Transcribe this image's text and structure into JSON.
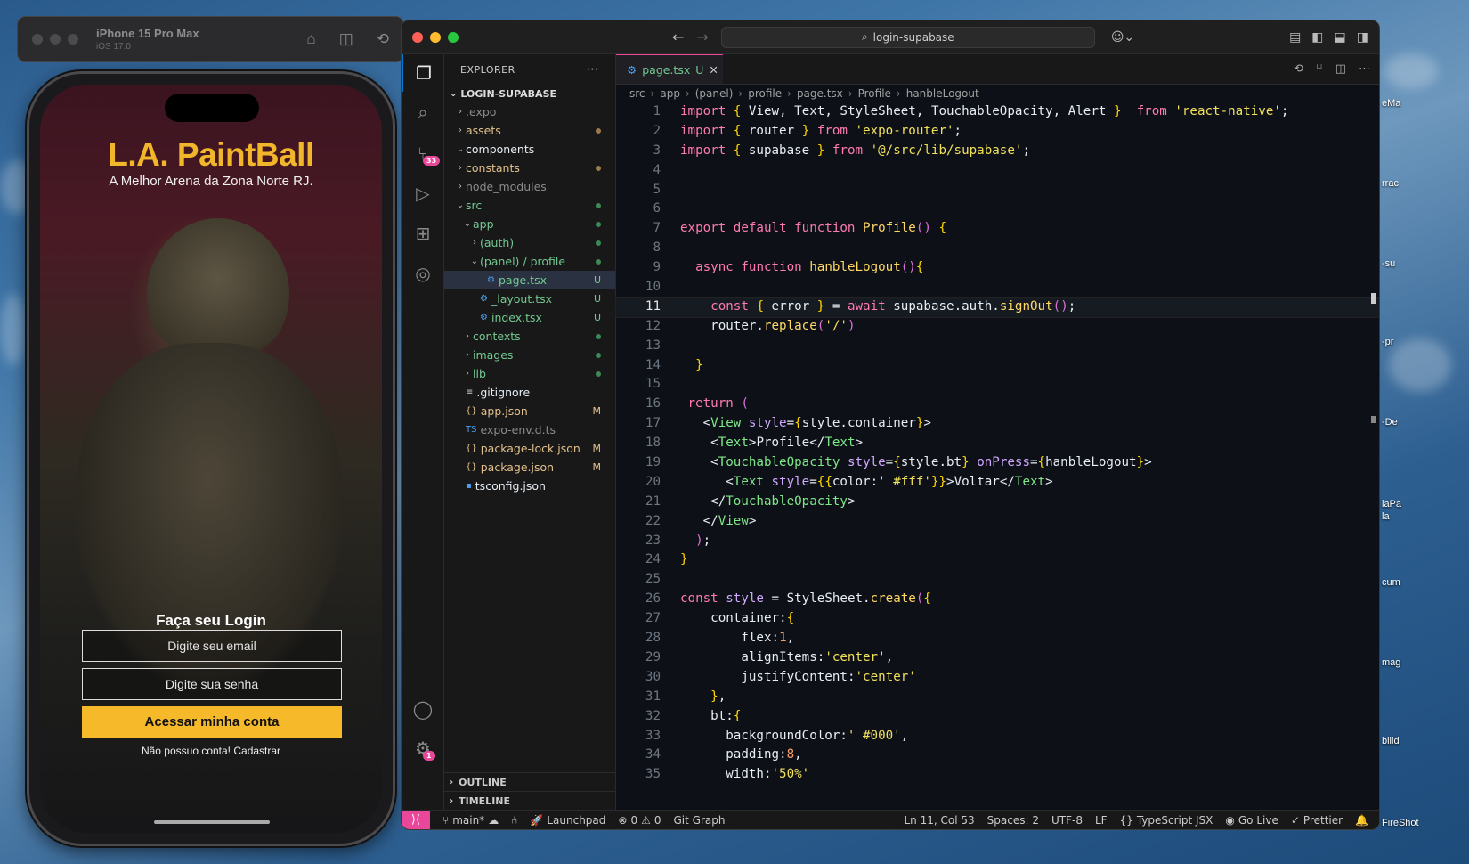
{
  "simulator": {
    "device": "iPhone 15 Pro Max",
    "os": "iOS 17.0"
  },
  "phone_app": {
    "title": "L.A. PaintBall",
    "subtitle": "A Melhor Arena da Zona Norte RJ.",
    "login_title": "Faça seu Login",
    "email_placeholder": "Digite seu email",
    "password_placeholder": "Digite sua senha",
    "login_button": "Acessar minha conta",
    "register_link": "Não possuo conta! Cadastrar",
    "title_color": "#f2b62a",
    "button_color": "#f6b92a"
  },
  "vscode": {
    "search": "login-supabase",
    "explorer_title": "EXPLORER",
    "project": "LOGIN-SUPABASE",
    "scm_badge": "33",
    "accounts_badge": "1",
    "tree": [
      {
        "label": ".expo",
        "indent": 1,
        "chev": "›",
        "color": "c-gray",
        "stat": ""
      },
      {
        "label": "assets",
        "indent": 1,
        "chev": "›",
        "color": "c-orange",
        "stat": "dot-orange"
      },
      {
        "label": "components",
        "indent": 1,
        "chev": "⌄",
        "color": "pl",
        "stat": ""
      },
      {
        "label": "constants",
        "indent": 1,
        "chev": "›",
        "color": "c-orange",
        "stat": "dot-orange"
      },
      {
        "label": "node_modules",
        "indent": 1,
        "chev": "›",
        "color": "c-gray",
        "stat": ""
      },
      {
        "label": "src",
        "indent": 1,
        "chev": "⌄",
        "color": "c-green",
        "stat": "dot-green"
      },
      {
        "label": "app",
        "indent": 2,
        "chev": "⌄",
        "color": "c-green",
        "stat": "dot-green"
      },
      {
        "label": "(auth)",
        "indent": 3,
        "chev": "›",
        "color": "c-green",
        "stat": "dot-green"
      },
      {
        "label": "(panel) / profile",
        "indent": 3,
        "chev": "⌄",
        "color": "c-green",
        "stat": "dot-green"
      },
      {
        "label": "page.tsx",
        "indent": 4,
        "chev": "",
        "icon": "⚙",
        "color": "c-green",
        "stat": "U",
        "sel": true
      },
      {
        "label": "_layout.tsx",
        "indent": 3,
        "chev": "",
        "icon": "⚙",
        "color": "c-green",
        "stat": "U"
      },
      {
        "label": "index.tsx",
        "indent": 3,
        "chev": "",
        "icon": "⚙",
        "color": "c-green",
        "stat": "U"
      },
      {
        "label": "contexts",
        "indent": 2,
        "chev": "›",
        "color": "c-green",
        "stat": "dot-green"
      },
      {
        "label": "images",
        "indent": 2,
        "chev": "›",
        "color": "c-green",
        "stat": "dot-green"
      },
      {
        "label": "lib",
        "indent": 2,
        "chev": "›",
        "color": "c-green",
        "stat": "dot-green"
      },
      {
        "label": ".gitignore",
        "indent": 1,
        "chev": "",
        "icon": "≡",
        "color": "pl",
        "stat": ""
      },
      {
        "label": "app.json",
        "indent": 1,
        "chev": "",
        "icon": "{}",
        "color": "c-orange",
        "stat": "M"
      },
      {
        "label": "expo-env.d.ts",
        "indent": 1,
        "chev": "",
        "icon": "TS",
        "color": "c-gray",
        "stat": ""
      },
      {
        "label": "package-lock.json",
        "indent": 1,
        "chev": "",
        "icon": "{}",
        "color": "c-orange",
        "stat": "M"
      },
      {
        "label": "package.json",
        "indent": 1,
        "chev": "",
        "icon": "{}",
        "color": "c-orange",
        "stat": "M"
      },
      {
        "label": "tsconfig.json",
        "indent": 1,
        "chev": "",
        "icon": "▪",
        "color": "pl",
        "stat": ""
      }
    ],
    "outline": "OUTLINE",
    "timeline": "TIMELINE",
    "tab": {
      "name": "page.tsx",
      "status": "U"
    },
    "breadcrumbs": [
      "src",
      "app",
      "(panel)",
      "profile",
      "page.tsx",
      "Profile",
      "hanbleLogout"
    ],
    "code_lines": [
      "import { View, Text, StyleSheet, TouchableOpacity, Alert }  from 'react-native';",
      "import { router } from 'expo-router';",
      "import { supabase } from '@/src/lib/supabase';",
      "",
      "",
      "",
      "export default function Profile() {",
      "",
      "  async function hanbleLogout(){",
      "",
      "    const { error } = await supabase.auth.signOut();",
      "    router.replace('/')",
      "",
      "  }",
      "",
      " return (",
      "   <View style={style.container}>",
      "    <Text>Profile</Text>",
      "    <TouchableOpacity style={style.bt} onPress={hanbleLogout}>",
      "      <Text style={{color:' #fff'}}>Voltar</Text>",
      "    </TouchableOpacity>",
      "   </View>",
      "  );",
      "}",
      "",
      "const style = StyleSheet.create({",
      "    container:{",
      "        flex:1,",
      "        alignItems:'center',",
      "        justifyContent:'center'",
      "    },",
      "    bt:{",
      "      backgroundColor:' #000',",
      "      padding:8,",
      "      width:'50%'"
    ],
    "current_line": 11,
    "status": {
      "branch": "main*",
      "launchpad": "Launchpad",
      "problems": "0",
      "warnings": "0",
      "git_graph": "Git Graph",
      "position": "Ln 11, Col 53",
      "spaces": "Spaces: 2",
      "encoding": "UTF-8",
      "eol": "LF",
      "language": "TypeScript JSX",
      "golive": "Go Live",
      "prettier": "Prettier"
    }
  },
  "desktop_labels": [
    "eMa",
    "rrac",
    "-su",
    "-pr",
    "-De",
    "laPa",
    "la",
    "cum",
    "mag",
    "bilid",
    "FireShot"
  ]
}
